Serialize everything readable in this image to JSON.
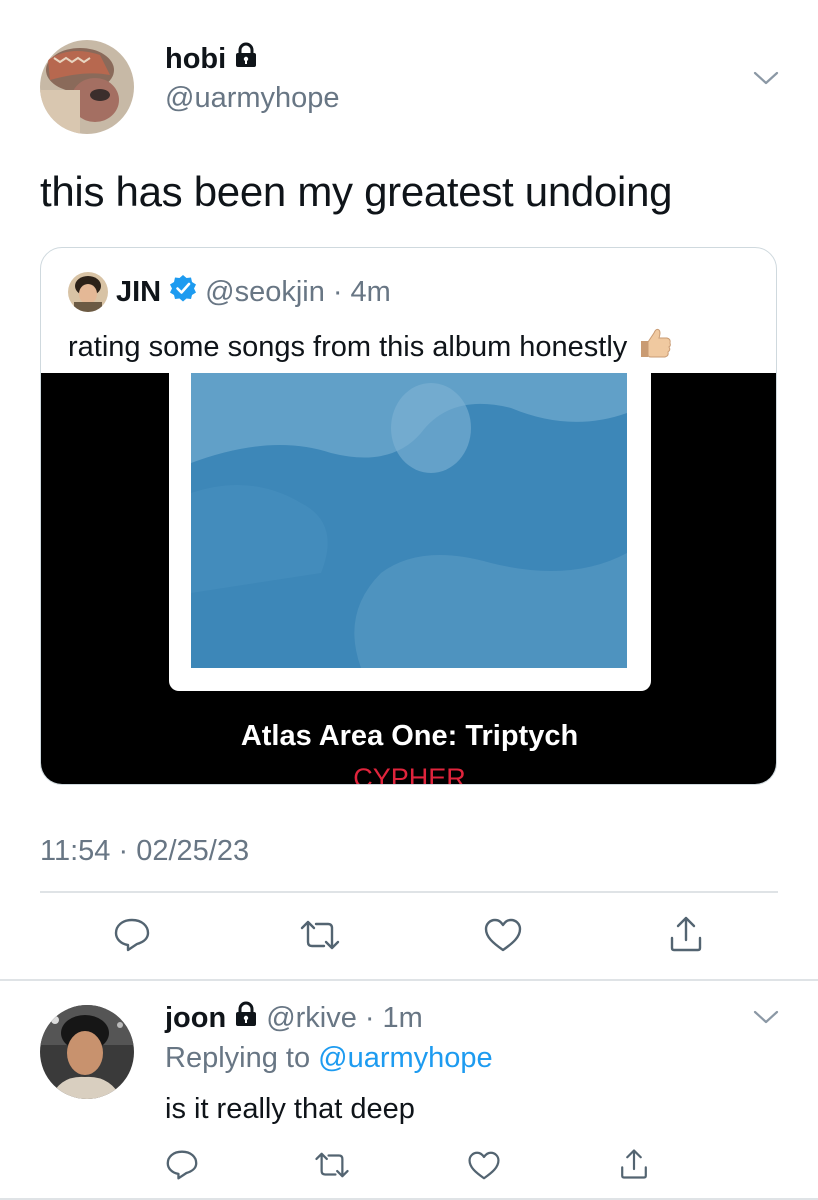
{
  "tweet": {
    "author_name": "hobi",
    "author_handle": "@uarmyhope",
    "text": "this has been my greatest undoing",
    "timestamp": "11:54 · 02/25/23",
    "icons": [
      "lock-icon",
      "chevron-down-icon",
      "reply-icon",
      "retweet-icon",
      "like-icon",
      "share-icon"
    ]
  },
  "quote": {
    "name": "JIN",
    "handle": "@seokjin",
    "separator": "·",
    "age": "4m",
    "text": "rating some songs from this album honestly",
    "emoji": "👍🏼",
    "media": {
      "album_title": "Atlas Area One: Triptych",
      "album_subtitle": "CYPHER"
    }
  },
  "reply": {
    "name": "joon",
    "handle": "@rkive",
    "separator": "·",
    "age": "1m",
    "replying_prefix": "Replying to",
    "replying_handle": "@uarmyhope",
    "text": "is it really that deep"
  },
  "colors": {
    "link": "#1d9bf0",
    "muted": "#687684",
    "verified": "#1d9bf0",
    "cypher_red": "#e0243c",
    "album_blue": "#3d87b8"
  }
}
